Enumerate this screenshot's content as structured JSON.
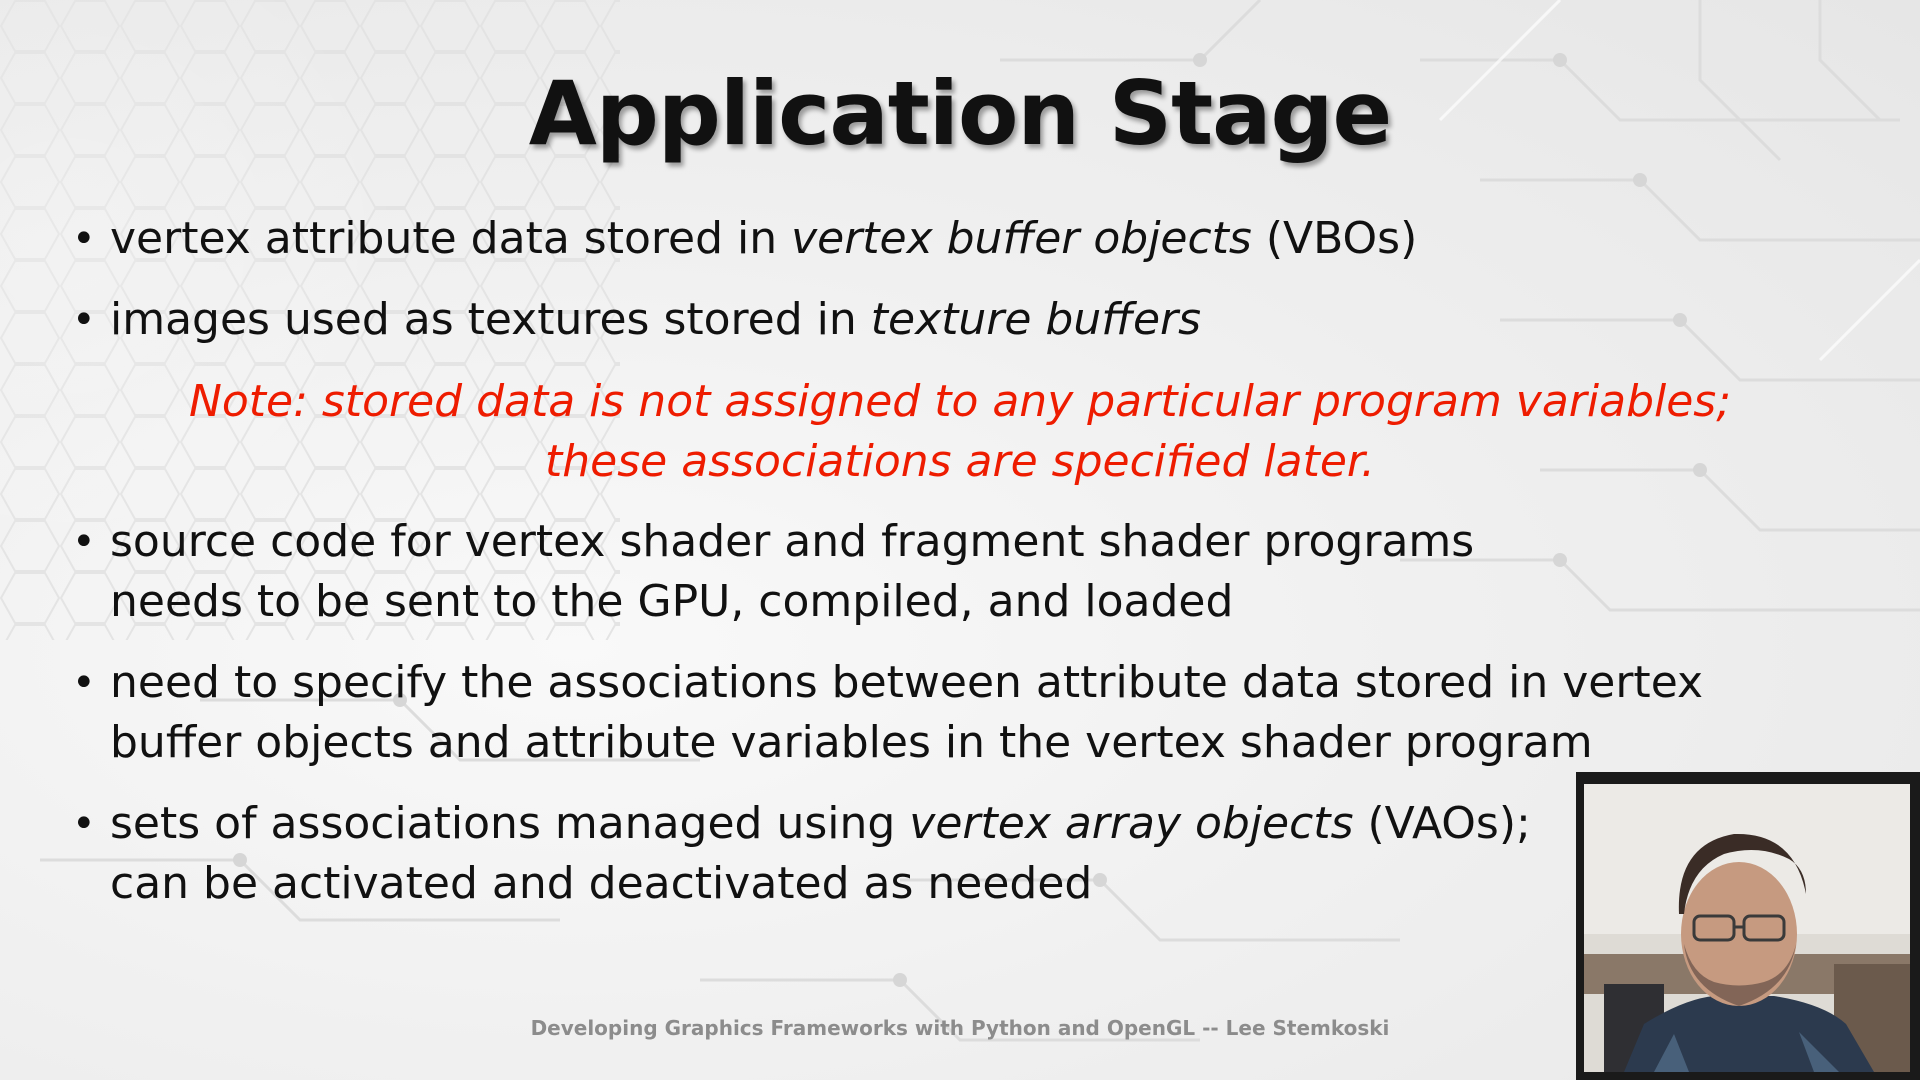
{
  "slide": {
    "title": "Application Stage",
    "bullets": [
      {
        "lines": [
          [
            "vertex attribute data stored in ",
            "vertex buffer objects",
            " (VBOs)"
          ]
        ]
      },
      {
        "lines": [
          [
            "images used as textures stored in ",
            "texture buffers",
            ""
          ]
        ]
      },
      {
        "lines": [
          [
            "source code for vertex shader and fragment shader programs",
            "",
            ""
          ],
          [
            "needs to be sent to the GPU, compiled, and loaded",
            "",
            ""
          ]
        ]
      },
      {
        "lines": [
          [
            "need to specify the associations between attribute data stored in vertex",
            "",
            ""
          ],
          [
            "buffer objects and attribute variables in the vertex shader program",
            "",
            ""
          ]
        ]
      },
      {
        "lines": [
          [
            "sets of associations managed using ",
            "vertex array objects",
            " (VAOs);"
          ],
          [
            "can be activated and deactivated as needed",
            "",
            ""
          ]
        ]
      }
    ],
    "note": {
      "line1": "Note: stored data is not assigned to any particular program variables;",
      "line2": "these associations are specified later."
    },
    "footer": "Developing Graphics Frameworks with Python and OpenGL -- Lee Stemkoski",
    "colors": {
      "note": "#ee1c00",
      "title": "#111111",
      "footer": "#8c8c8c"
    }
  },
  "webcam": {
    "description_icon": "presenter-webcam"
  }
}
